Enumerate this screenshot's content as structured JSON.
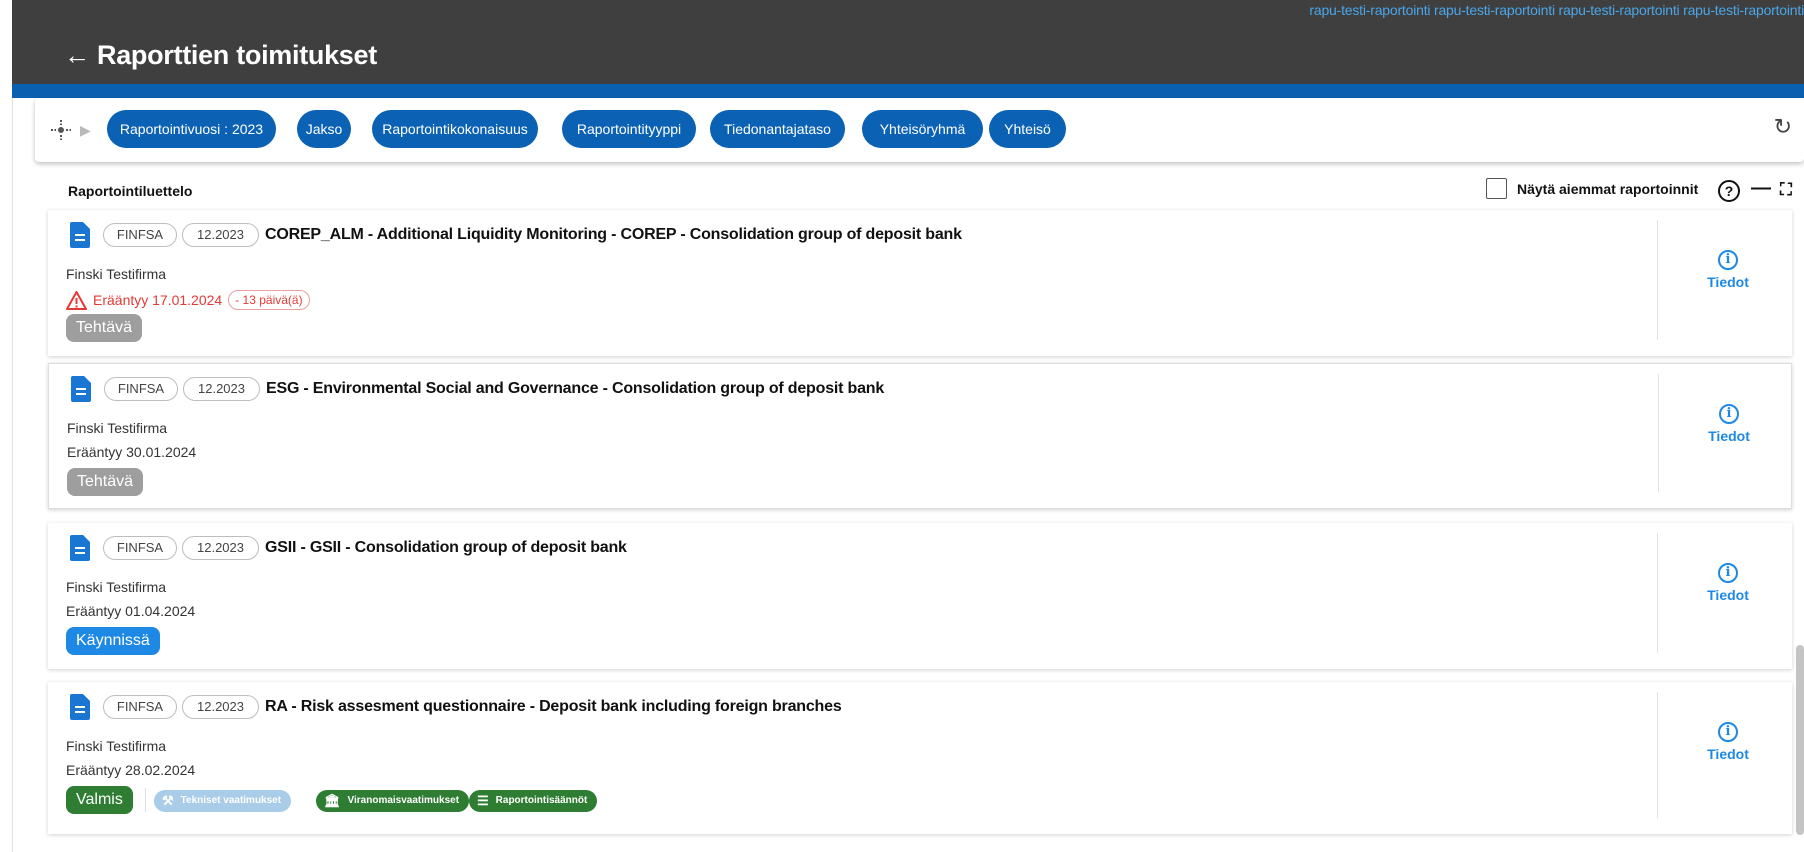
{
  "header": {
    "back_icon": "←",
    "title": "Raporttien toimitukset",
    "user_text": "rapu-testi-raportointi rapu-testi-raportointi rapu-testi-raportointi rapu-testi-raportointi"
  },
  "filters": {
    "chips": [
      "Raportointivuosi : 2023",
      "Jakso",
      "Raportointikokonaisuus",
      "Raportointityyppi",
      "Tiedonantajataso",
      "Yhteisöryhmä",
      "Yhteisö"
    ]
  },
  "list": {
    "title": "Raportointiluettelo",
    "show_previous": "Näytä aiemmat raportoinnit",
    "help": "?",
    "minimize": "—",
    "expand": "⛶"
  },
  "reports": [
    {
      "authority": "FINFSA",
      "period": "12.2023",
      "title": "COREP_ALM - Additional Liquidity Monitoring - COREP - Consolidation group of deposit bank",
      "company": "Finski Testifirma",
      "due": "Erääntyy 17.01.2024",
      "days": "- 13 päivä(ä)",
      "status": "Tehtävä",
      "info": "Tiedot"
    },
    {
      "authority": "FINFSA",
      "period": "12.2023",
      "title": "ESG - Environmental Social and Governance - Consolidation group of deposit bank",
      "company": "Finski Testifirma",
      "due": "Erääntyy 30.01.2024",
      "status": "Tehtävä",
      "info": "Tiedot"
    },
    {
      "authority": "FINFSA",
      "period": "12.2023",
      "title": "GSII - GSII - Consolidation group of deposit bank",
      "company": "Finski Testifirma",
      "due": "Erääntyy 01.04.2024",
      "status": "Käynnissä",
      "info": "Tiedot"
    },
    {
      "authority": "FINFSA",
      "period": "12.2023",
      "title": "RA - Risk assesment questionnaire - Deposit bank including foreign branches",
      "company": "Finski Testifirma",
      "due": "Erääntyy 28.02.2024",
      "status": "Valmis",
      "info": "Tiedot",
      "requirements": [
        "Tekniset vaatimukset",
        "Viranomaisvaatimukset",
        "Raportointisäännöt"
      ]
    }
  ]
}
